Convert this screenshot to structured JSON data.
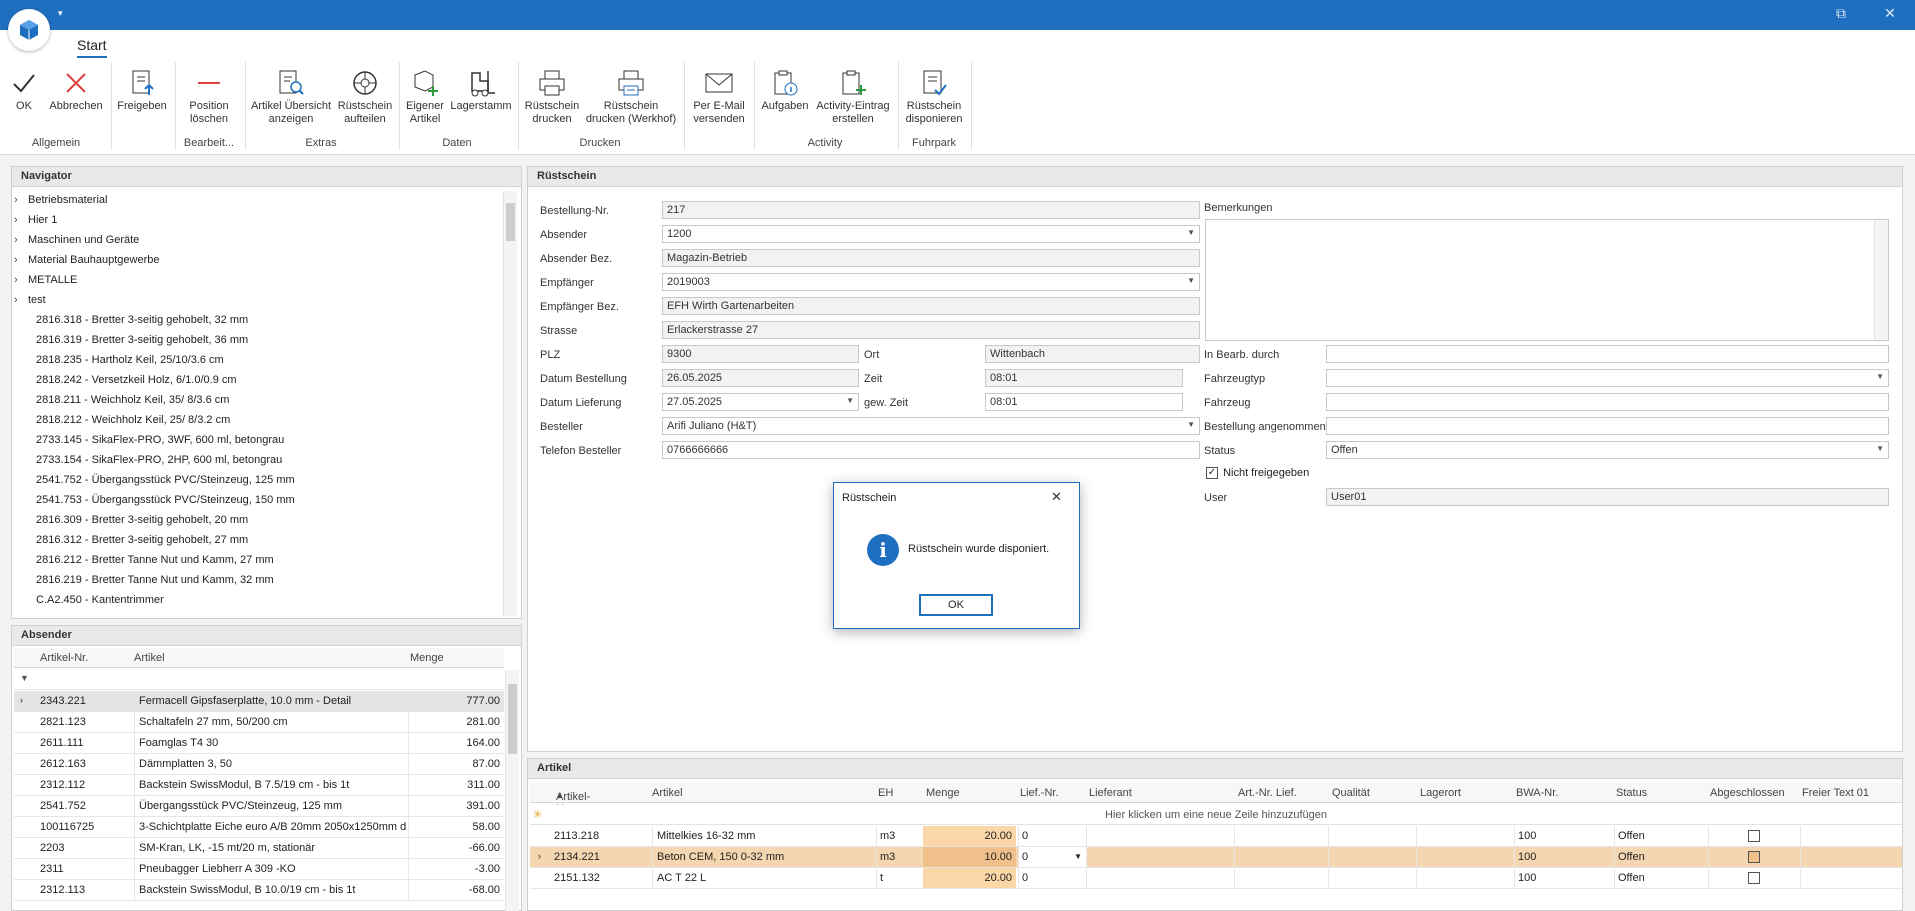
{
  "window": {
    "minimize_glyph": "⧉",
    "close_glyph": "✕",
    "qa_glyph": "▾"
  },
  "ribbon": {
    "tab": "Start",
    "buttons": {
      "ok": "OK",
      "abbrechen": "Abbrechen",
      "freigeben": "Freigeben",
      "position_loeschen_1": "Position",
      "position_loeschen_2": "löschen",
      "artikel_uebersicht_1": "Artikel Übersicht",
      "artikel_uebersicht_2": "anzeigen",
      "ruestschein_aufteilen_1": "Rüstschein",
      "ruestschein_aufteilen_2": "aufteilen",
      "eigener_artikel_1": "Eigener",
      "eigener_artikel_2": "Artikel",
      "lagerstamm": "Lagerstamm",
      "ruestschein_drucken_1": "Rüstschein",
      "ruestschein_drucken_2": "drucken",
      "ruestschein_werkhof_1": "Rüstschein",
      "ruestschein_werkhof_2": "drucken (Werkhof)",
      "email_1": "Per E-Mail",
      "email_2": "versenden",
      "aufgaben": "Aufgaben",
      "activity_1": "Activity-Eintrag",
      "activity_2": "erstellen",
      "disponieren_1": "Rüstschein",
      "disponieren_2": "disponieren"
    },
    "groups": {
      "allgemein": "Allgemein",
      "bearbeiten": "Bearbeit...",
      "extras": "Extras",
      "daten": "Daten",
      "drucken": "Drucken",
      "activity": "Activity",
      "fuhrpark": "Fuhrpark"
    }
  },
  "navigator": {
    "title": "Navigator",
    "folders": [
      "Betriebsmaterial",
      "Hier 1",
      "Maschinen und Geräte",
      "Material Bauhauptgewerbe",
      "METALLE",
      "test"
    ],
    "items": [
      "2816.318 - Bretter 3-seitig gehobelt, 32 mm",
      "2816.319 - Bretter 3-seitig gehobelt, 36 mm",
      "2818.235 - Hartholz Keil, 25/10/3.6 cm",
      "2818.242 - Versetzkeil Holz, 6/1.0/0.9 cm",
      "2818.211 - Weichholz Keil, 35/ 8/3.6 cm",
      "2818.212 - Weichholz Keil, 25/ 8/3.2 cm",
      "2733.145 - SikaFlex-PRO, 3WF, 600 ml, betongrau",
      "2733.154 - SikaFlex-PRO, 2HP, 600 ml, betongrau",
      "2541.752 - Übergangsstück PVC/Steinzeug, 125 mm",
      "2541.753 - Übergangsstück PVC/Steinzeug, 150 mm",
      "2816.309 - Bretter 3-seitig gehobelt, 20 mm",
      "2816.312 - Bretter 3-seitig gehobelt, 27 mm",
      "2816.212 - Bretter Tanne Nut und Kamm, 27 mm",
      "2816.219 - Bretter Tanne Nut und Kamm, 32 mm",
      "C.A2.450 - Kantentrimmer"
    ]
  },
  "absender": {
    "title": "Absender",
    "columns": {
      "nr": "Artikel-Nr.",
      "artikel": "Artikel",
      "menge": "Menge"
    },
    "filter_glyph": "▼",
    "rows": [
      {
        "nr": "2343.221",
        "artikel": "Fermacell Gipsfaserplatte, 10.0 mm - Detail",
        "menge": "777.00"
      },
      {
        "nr": "2821.123",
        "artikel": "Schaltafeln 27 mm, 50/200 cm",
        "menge": "281.00"
      },
      {
        "nr": "2611.111",
        "artikel": "Foamglas  T4   30",
        "menge": "164.00"
      },
      {
        "nr": "2612.163",
        "artikel": "Dämmplatten 3, 50",
        "menge": "87.00"
      },
      {
        "nr": "2312.112",
        "artikel": "Backstein SwissModul, B 7.5/19 cm - bis 1t",
        "menge": "311.00"
      },
      {
        "nr": "2541.752",
        "artikel": "Übergangsstück PVC/Steinzeug, 125 mm",
        "menge": "391.00"
      },
      {
        "nr": "100116725",
        "artikel": "3-Schichtplatte Eiche euro A/B 20mm 2050x1250mm d...",
        "menge": "58.00"
      },
      {
        "nr": "2203",
        "artikel": "SM-Kran, LK, -15 mt/20 m, stationär",
        "menge": "-66.00"
      },
      {
        "nr": "2311",
        "artikel": "Pneubagger Liebherr A 309 -KO",
        "menge": "-3.00"
      },
      {
        "nr": "2312.113",
        "artikel": "Backstein SwissModul, B 10.0/19 cm - bis 1t",
        "menge": "-68.00"
      }
    ]
  },
  "ruestschein": {
    "title": "Rüstschein",
    "labels": {
      "bestellung_nr": "Bestellung-Nr.",
      "absender": "Absender",
      "absender_bez": "Absender Bez.",
      "empfaenger": "Empfänger",
      "empfaenger_bez": "Empfänger Bez.",
      "strasse": "Strasse",
      "plz": "PLZ",
      "ort": "Ort",
      "datum_bestellung": "Datum Bestellung",
      "zeit": "Zeit",
      "datum_lieferung": "Datum Lieferung",
      "gew_zeit": "gew. Zeit",
      "besteller": "Besteller",
      "telefon": "Telefon Besteller",
      "bemerkungen": "Bemerkungen",
      "in_bearb": "In Bearb. durch",
      "fahrzeugtyp": "Fahrzeugtyp",
      "fahrzeug": "Fahrzeug",
      "angenommen": "Bestellung angenommen",
      "status": "Status",
      "nicht_freigegeben": "Nicht freigegeben",
      "user": "User"
    },
    "values": {
      "bestellung_nr": "217",
      "absender": "1200",
      "absender_bez": "Magazin-Betrieb",
      "empfaenger": "2019003",
      "empfaenger_bez": "EFH Wirth Gartenarbeiten",
      "strasse": "Erlackerstrasse 27",
      "plz": "9300",
      "ort": "Wittenbach",
      "datum_bestellung": "26.05.2025",
      "zeit": "08:01",
      "datum_lieferung": "27.05.2025",
      "gew_zeit": "08:01",
      "besteller": "Arifi Juliano (H&T)",
      "telefon": "0766666666",
      "status": "Offen",
      "user": "User01"
    },
    "checkmark": "✓"
  },
  "artikel": {
    "title": "Artikel",
    "columns": {
      "nr": "Artikel-Nr.",
      "artikel": "Artikel",
      "eh": "EH",
      "menge": "Menge",
      "lief_nr": "Lief.-Nr.",
      "lieferant": "Lieferant",
      "art_nr_lief": "Art.-Nr. Lief.",
      "qualitaet": "Qualität",
      "lagerort": "Lagerort",
      "bwa_nr": "BWA-Nr.",
      "status": "Status",
      "abgeschlossen": "Abgeschlossen",
      "freier_text": "Freier Text 01"
    },
    "new_row_hint": "Hier klicken um eine neue Zeile hinzuzufügen",
    "rows": [
      {
        "nr": "2113.218",
        "artikel": "Mittelkies 16-32 mm",
        "eh": "m3",
        "menge": "20.00",
        "lief_nr": "0",
        "bwa": "100",
        "status": "Offen"
      },
      {
        "nr": "2134.221",
        "artikel": "Beton CEM, 150  0-32 mm",
        "eh": "m3",
        "menge": "10.00",
        "lief_nr": "0",
        "bwa": "100",
        "status": "Offen"
      },
      {
        "nr": "2151.132",
        "artikel": "AC T 22 L",
        "eh": "t",
        "menge": "20.00",
        "lief_nr": "0",
        "bwa": "100",
        "status": "Offen"
      }
    ]
  },
  "dialog": {
    "title": "Rüstschein",
    "message": "Rüstschein wurde disponiert.",
    "ok": "OK",
    "close_glyph": "✕",
    "info_glyph": "i"
  }
}
